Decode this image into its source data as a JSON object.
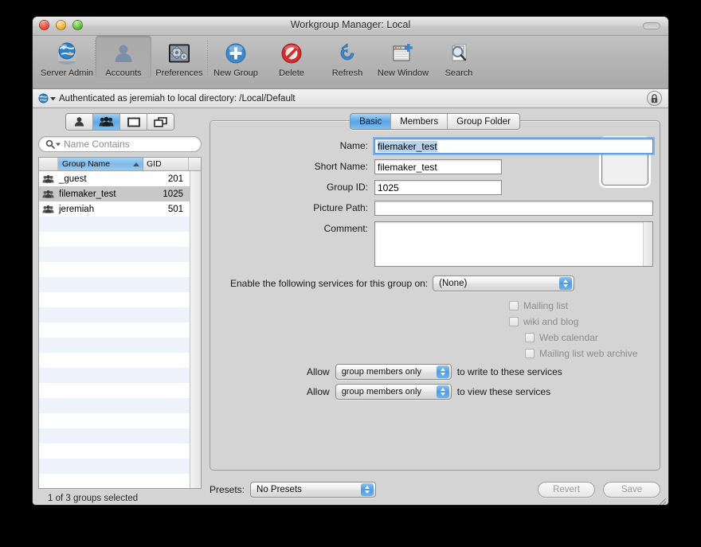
{
  "window": {
    "title": "Workgroup Manager: Local"
  },
  "toolbar": {
    "items": [
      {
        "label": "Server Admin",
        "icon": "server-globe-icon",
        "selected": false
      },
      {
        "label": "Accounts",
        "icon": "user-silhouette-icon",
        "selected": true
      },
      {
        "label": "Preferences",
        "icon": "gears-icon",
        "selected": false
      },
      {
        "label": "New Group",
        "icon": "plus-circle-icon",
        "selected": false
      },
      {
        "label": "Delete",
        "icon": "no-entry-icon",
        "selected": false
      },
      {
        "label": "Refresh",
        "icon": "refresh-arrow-icon",
        "selected": false
      },
      {
        "label": "New Window",
        "icon": "new-window-icon",
        "selected": false
      },
      {
        "label": "Search",
        "icon": "magnifier-pages-icon",
        "selected": false
      }
    ]
  },
  "auth_bar": {
    "text": "Authenticated as jeremiah to local directory: /Local/Default",
    "globe_icon": "globe-icon",
    "lock_icon": "lock-closed-icon"
  },
  "sidebar": {
    "segments": [
      {
        "name": "users",
        "icon": "user-icon",
        "selected": false
      },
      {
        "name": "groups",
        "icon": "groups-icon",
        "selected": true
      },
      {
        "name": "computers",
        "icon": "computer-icon",
        "selected": false
      },
      {
        "name": "computer-groups",
        "icon": "computer-group-icon",
        "selected": false
      }
    ],
    "search": {
      "placeholder": "Name Contains",
      "icon": "search-icon"
    },
    "table": {
      "columns": [
        "Group Name",
        "GID"
      ],
      "sort_column": "Group Name",
      "sort_direction": "ascending",
      "rows": [
        {
          "name": "_guest",
          "gid": "201",
          "selected": false
        },
        {
          "name": "filemaker_test",
          "gid": "1025",
          "selected": true
        },
        {
          "name": "jeremiah",
          "gid": "501",
          "selected": false
        }
      ]
    },
    "status": "1 of 3 groups selected"
  },
  "tabs": [
    {
      "label": "Basic",
      "active": true
    },
    {
      "label": "Members",
      "active": false
    },
    {
      "label": "Group Folder",
      "active": false
    }
  ],
  "form": {
    "name_label": "Name:",
    "name_value": "filemaker_test",
    "short_name_label": "Short Name:",
    "short_name_value": "filemaker_test",
    "group_id_label": "Group ID:",
    "group_id_value": "1025",
    "picture_path_label": "Picture Path:",
    "picture_path_value": "",
    "comment_label": "Comment:",
    "comment_value": "",
    "picture_well": "group-picture-well"
  },
  "services": {
    "label": "Enable the following services for this group on:",
    "selected": "(None)",
    "checkboxes": [
      {
        "label": "Mailing list",
        "checked": false,
        "indent": 0
      },
      {
        "label": "wiki and blog",
        "checked": false,
        "indent": 0
      },
      {
        "label": "Web calendar",
        "checked": false,
        "indent": 1
      },
      {
        "label": "Mailing list web archive",
        "checked": false,
        "indent": 1
      }
    ],
    "allow_rows": [
      {
        "prefix": "Allow",
        "value": "group members only",
        "suffix": "to write to these services"
      },
      {
        "prefix": "Allow",
        "value": "group members only",
        "suffix": "to view these services"
      }
    ]
  },
  "bottom": {
    "presets_label": "Presets:",
    "presets_value": "No Presets",
    "revert_label": "Revert",
    "save_label": "Save"
  },
  "colors": {
    "accent_blue": "#5aa5e4",
    "selection_grey": "#c8c8c8",
    "stripe_blue": "#edf2fb",
    "window_grey": "#d4d4d4"
  }
}
